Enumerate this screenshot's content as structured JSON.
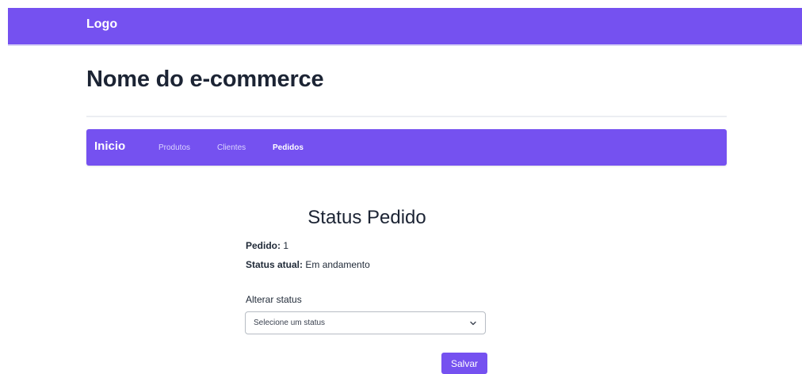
{
  "header": {
    "logo": "Logo"
  },
  "site": {
    "title": "Nome do e-commerce"
  },
  "nav": {
    "brand": "Inicio",
    "links": [
      {
        "label": "Produtos",
        "active": false
      },
      {
        "label": "Clientes",
        "active": false
      },
      {
        "label": "Pedidos",
        "active": true
      }
    ]
  },
  "panel": {
    "title": "Status Pedido",
    "order_label": "Pedido:",
    "order_value": "1",
    "status_label": "Status atual:",
    "status_value": "Em andamento",
    "change_label": "Alterar status",
    "select_value": "Selecione um status",
    "save_label": "Salvar"
  },
  "colors": {
    "accent": "#7551f0",
    "heading": "#1c2434",
    "divider": "#eceef2"
  },
  "icons": {
    "select_arrow": "chevron-down-icon"
  }
}
